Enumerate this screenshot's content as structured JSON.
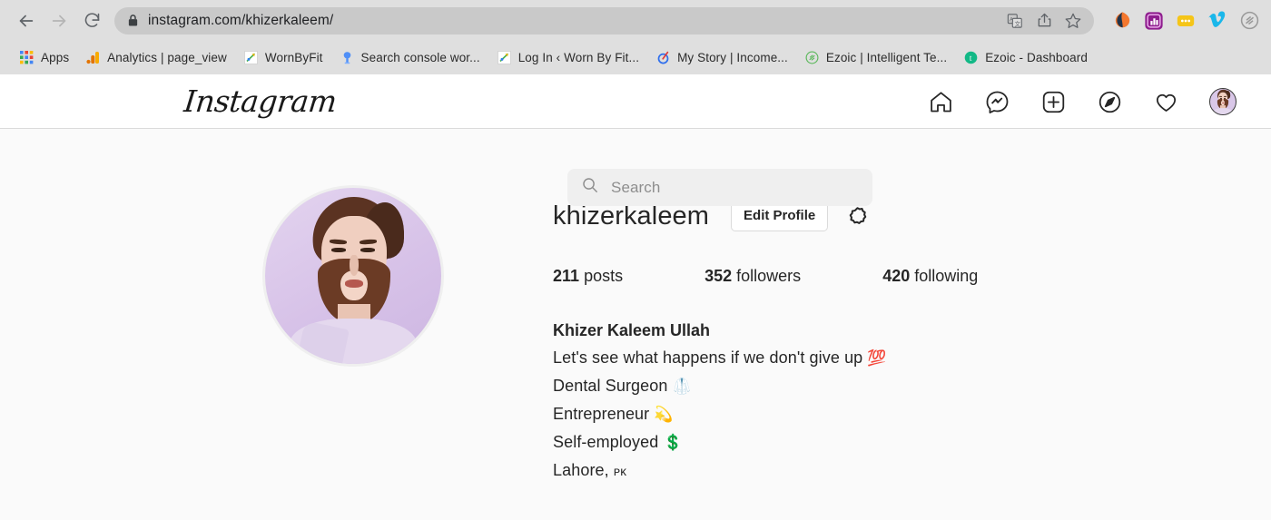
{
  "browser": {
    "back_icon": "back-arrow-icon",
    "forward_icon": "forward-arrow-icon",
    "reload_icon": "reload-icon",
    "lock_icon": "lock-icon",
    "url": "instagram.com/khizerkaleem/",
    "omnibox_actions": [
      {
        "name": "translate-icon"
      },
      {
        "name": "share-icon"
      },
      {
        "name": "bookmark-star-icon"
      }
    ],
    "extensions": [
      {
        "name": "similarweb-extension-icon",
        "color": "#f07c1e"
      },
      {
        "name": "analytics-extension-icon",
        "color": "#7b1fa2"
      },
      {
        "name": "menu-dots-extension-icon",
        "color": "#f5c518"
      },
      {
        "name": "vimeo-extension-icon",
        "color": "#1ab7ea"
      },
      {
        "name": "ezoic-extension-icon",
        "color": "#9e9e9e"
      }
    ]
  },
  "bookmarks": [
    {
      "label": "Apps",
      "icon": "apps-grid-icon"
    },
    {
      "label": "Analytics | page_view",
      "icon": "google-analytics-icon"
    },
    {
      "label": "WornByFit",
      "icon": "wornbyfit-icon"
    },
    {
      "label": "Search console wor...",
      "icon": "search-console-icon"
    },
    {
      "label": "Log In ‹ Worn By Fit...",
      "icon": "wordpress-login-icon"
    },
    {
      "label": "My Story | Income...",
      "icon": "my-story-icon"
    },
    {
      "label": "Ezoic | Intelligent Te...",
      "icon": "ezoic-green-icon"
    },
    {
      "label": "Ezoic - Dashboard",
      "icon": "ezoic-teal-icon"
    }
  ],
  "instagram": {
    "logo_text": "Instagram",
    "search": {
      "placeholder": "Search",
      "value": "",
      "icon": "search-icon"
    },
    "nav": [
      {
        "name": "home-icon",
        "label": "Home"
      },
      {
        "name": "messenger-icon",
        "label": "Messages"
      },
      {
        "name": "new-post-icon",
        "label": "New post"
      },
      {
        "name": "explore-compass-icon",
        "label": "Explore"
      },
      {
        "name": "activity-heart-icon",
        "label": "Activity"
      },
      {
        "name": "profile-avatar",
        "label": "Profile"
      }
    ],
    "profile": {
      "avatar_name": "profile-picture",
      "username": "khizerkaleem",
      "edit_profile_label": "Edit Profile",
      "settings_icon": "settings-gear-icon",
      "stats": [
        {
          "name": "posts",
          "count": "211",
          "label": "posts"
        },
        {
          "name": "followers",
          "count": "352",
          "label": "followers"
        },
        {
          "name": "following",
          "count": "420",
          "label": "following"
        }
      ],
      "full_name": "Khizer Kaleem Ullah",
      "bio_lines": [
        {
          "text": "Let's see what happens if we don't give up ",
          "emoji": "💯"
        },
        {
          "text": "Dental Surgeon ",
          "emoji": "🥼"
        },
        {
          "text": "Entrepreneur ",
          "emoji": "💫"
        },
        {
          "text": "Self-employed ",
          "emoji": "💲"
        }
      ],
      "location_city": "Lahore, ",
      "location_country": "ᴘᴋ"
    }
  },
  "colors": {
    "chrome_bg": "#dfdfdf",
    "omnibox_bg": "#c9c9c9",
    "page_bg": "#fafafa",
    "header_bg": "#ffffff",
    "text_primary": "#262626",
    "text_muted": "#8e8e8e",
    "border": "#dbdbdb"
  }
}
